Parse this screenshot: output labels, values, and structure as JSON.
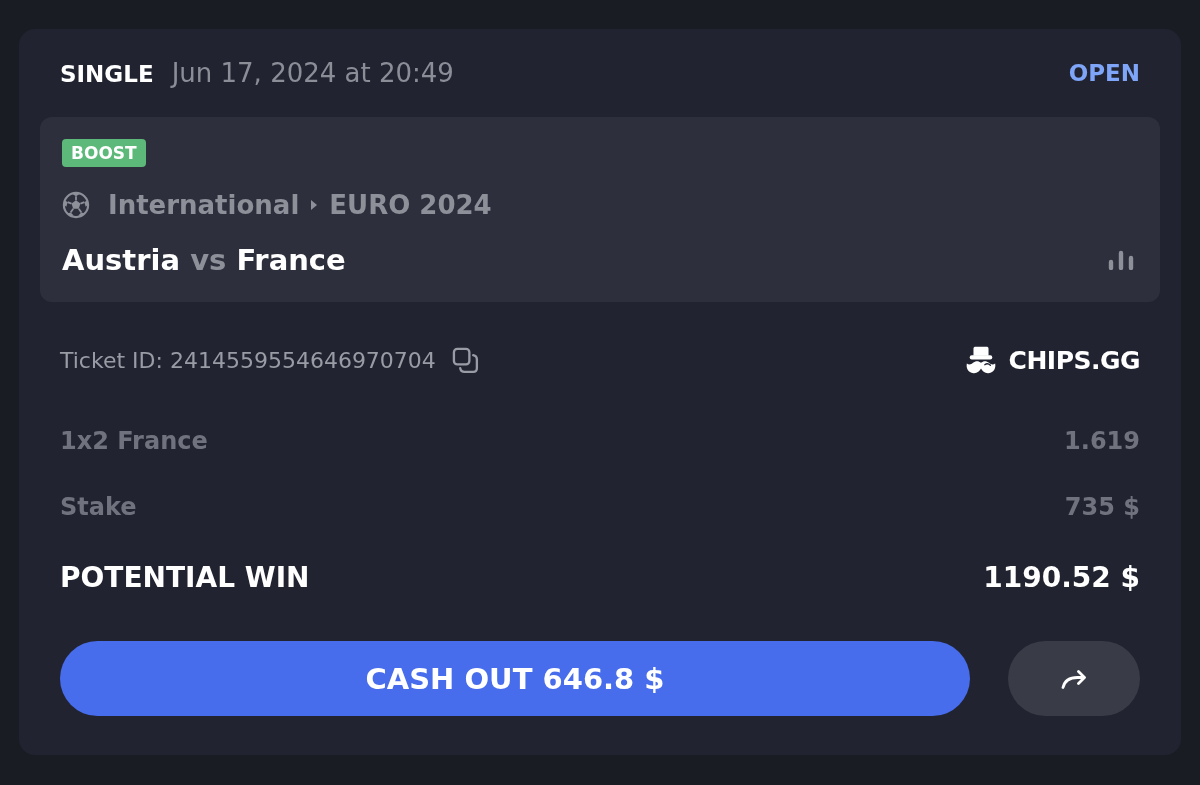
{
  "bet": {
    "type": "SINGLE",
    "placed_at": "Jun 17, 2024 at 20:49",
    "status": "OPEN"
  },
  "event": {
    "badge": "BOOST",
    "breadcrumb": [
      "International",
      "EURO 2024"
    ],
    "home": "Austria",
    "separator": "vs",
    "away": "France"
  },
  "ticket": {
    "label": "Ticket ID: 2414559554646970704",
    "brand": "CHIPS.GG"
  },
  "lines": [
    {
      "kind": "detail",
      "label": "1x2 France",
      "value": "1.619"
    },
    {
      "kind": "detail",
      "label": "Stake",
      "value": "735 $"
    },
    {
      "kind": "total",
      "label": "POTENTIAL WIN",
      "value": "1190.52 $"
    }
  ],
  "actions": {
    "cash_out": "CASH OUT 646.8 $"
  }
}
